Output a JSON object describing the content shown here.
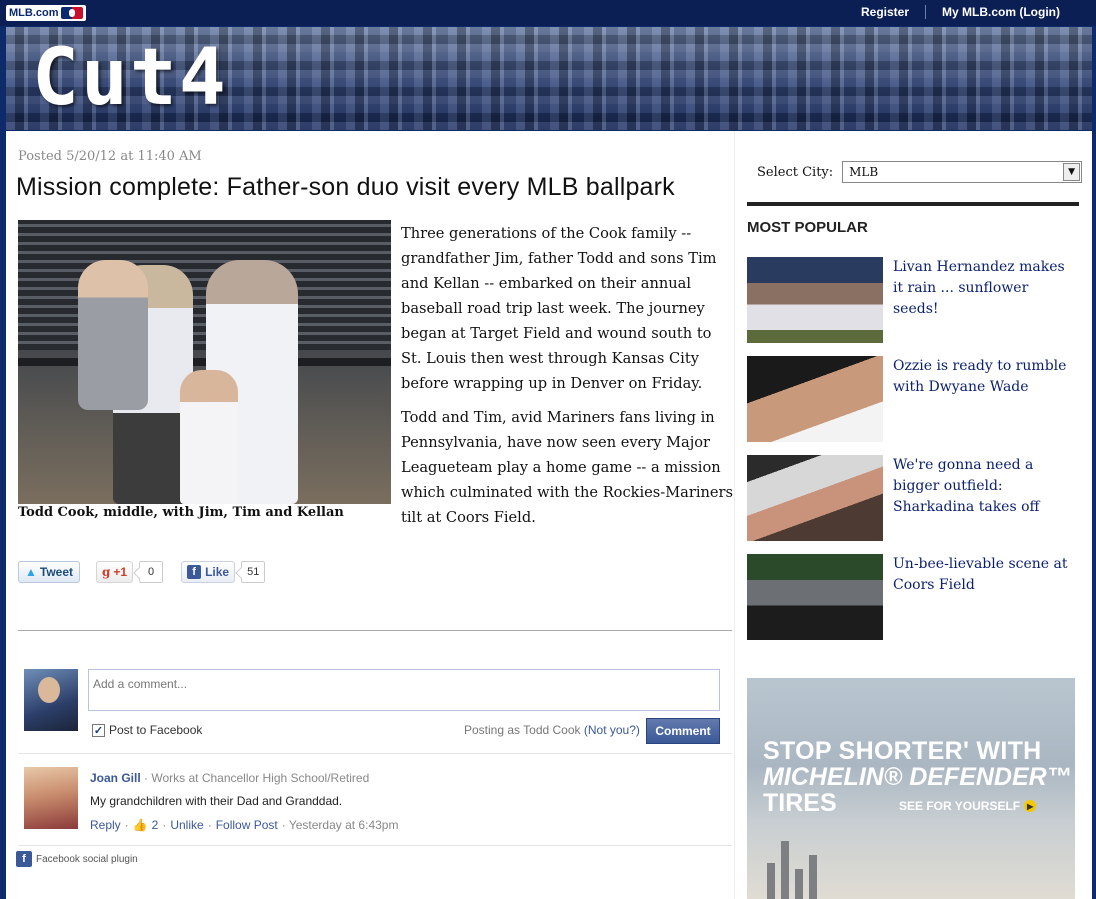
{
  "topbar": {
    "logo_text": "MLB.com",
    "register": "Register",
    "my_mlb": "My MLB.com (Login)"
  },
  "banner": {
    "title": "Cut4"
  },
  "article": {
    "posted": "Posted 5/20/12 at 11:40 AM",
    "headline": "Mission complete: Father-son duo visit every MLB ballpark",
    "caption": "Todd Cook, middle, with Jim, Tim and Kellan",
    "paragraphs": [
      "Three generations of the Cook family -- grandfather Jim, father Todd and sons Tim and Kellan -- embarked on their annual baseball road trip last week. The journey began at Target Field and wound south to St. Louis then west through Kansas City before wrapping up in Denver on Friday.",
      "Todd and Tim, avid Mariners fans living in Pennsylvania, have now seen every Major Leagueteam play a home game -- a mission which culminated with the Rockies-Mariners tilt at Coors Field."
    ]
  },
  "social": {
    "tweet": "Tweet",
    "gplus": "+1",
    "gplus_count": "0",
    "like": "Like",
    "like_count": "51"
  },
  "comments": {
    "placeholder": "Add a comment...",
    "post_to_facebook": "Post to Facebook",
    "posting_as": "Posting as Todd Cook",
    "not_you": "(Not you?)",
    "comment_button": "Comment",
    "items": [
      {
        "name": "Joan Gill",
        "meta": "· Works at Chancellor High School/Retired",
        "text": "My grandchildren with their Dad and Granddad.",
        "reply": "Reply",
        "likes": "2",
        "unlike": "Unlike",
        "follow": "Follow Post",
        "time": "· Yesterday at 6:43pm"
      }
    ],
    "plugin_label": "Facebook social plugin"
  },
  "sidebar": {
    "select_label": "Select City:",
    "select_value": "MLB",
    "most_popular": "MOST POPULAR",
    "popular": [
      {
        "title": "Livan Hernandez makes it rain ... sunflower seeds!"
      },
      {
        "title": "Ozzie is ready to rumble with Dwyane Wade"
      },
      {
        "title": "We're gonna need a bigger outfield: Sharkadina takes off"
      },
      {
        "title": "Un-bee-lievable scene at Coors Field"
      }
    ]
  },
  "ad": {
    "line1": "STOP SHORTER' WITH",
    "line2": "MICHELIN® DEFENDER™",
    "line3": "TIRES",
    "cta": "SEE FOR YOURSELF"
  },
  "colors": {
    "page_bg": "#0d2a6b",
    "link": "#0a1f6e",
    "facebook_blue": "#3b5998"
  }
}
